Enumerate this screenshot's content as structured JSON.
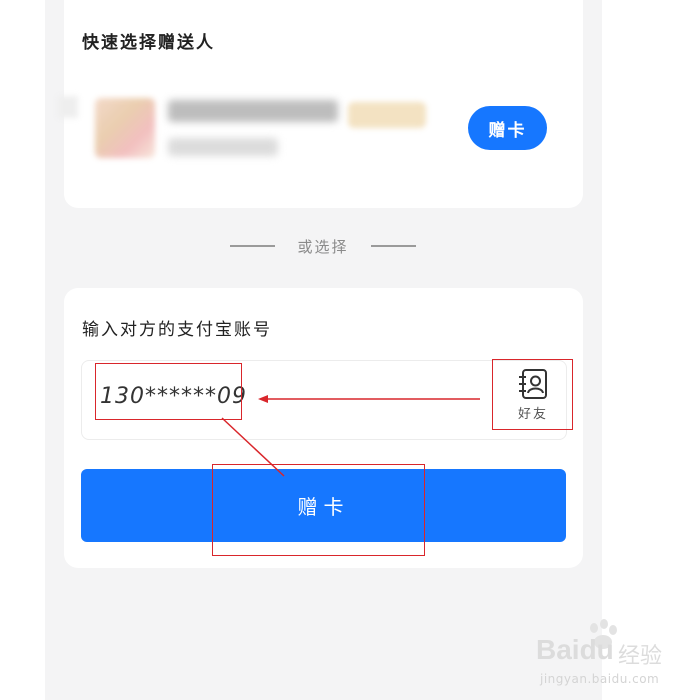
{
  "quick_gift": {
    "title": "快速选择赠送人",
    "gift_button_label": "赠卡"
  },
  "divider": {
    "text": "或选择"
  },
  "account_input": {
    "title": "输入对方的支付宝账号",
    "value": "130******09",
    "contacts_label": "好友",
    "contacts_icon": "contact-book-icon"
  },
  "submit": {
    "label": "赠卡"
  },
  "watermark": {
    "brand": "Baidu",
    "suffix": "经验",
    "url": "jingyan.baidu.com"
  },
  "colors": {
    "accent": "#1677ff",
    "annotation": "#d9262b",
    "background": "#f4f4f5"
  }
}
